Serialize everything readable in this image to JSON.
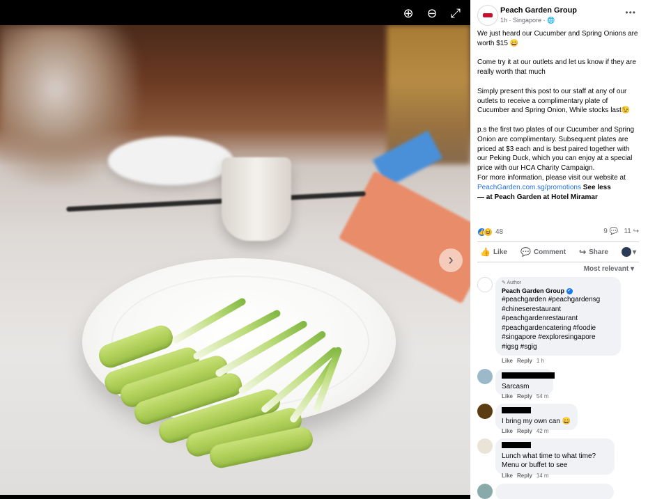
{
  "viewer": {
    "controls": [
      {
        "name": "zoom-in-icon",
        "glyph": "⊕"
      },
      {
        "name": "zoom-out-icon",
        "glyph": "⊖"
      },
      {
        "name": "fullscreen-icon",
        "glyph": "⤢"
      }
    ],
    "next_glyph": "›"
  },
  "post": {
    "page_name": "Peach Garden Group",
    "time": "1h",
    "location": "Singapore",
    "privacy_icon": "globe-icon",
    "more_label": "•••",
    "paragraphs": [
      "We just heard our Cucumber and Spring Onions are worth $15 😄",
      "Come try it at our outlets and let us know if they are really worth that much",
      "Simply present this post to our staff at any of our outlets to receive a complimentary plate of Cucumber and Spring Onion, While stocks last😉"
    ],
    "ps_text": "p.s the first two plates of our Cucumber and Spring Onion are complimentary. Subsequent plates are priced at $3 each and is best paired together with our Peking Duck, which you can enjoy at a special price with our HCA Charity Campaign.",
    "info_text": "For more information, please visit our website at",
    "link": "PeachGarden.com.sg/promotions",
    "see_less": "See less",
    "location_line": "— at Peach Garden at Hotel Miramar"
  },
  "stats": {
    "reactions": "48",
    "comments": "9",
    "shares": "11"
  },
  "actions": {
    "like": "Like",
    "comment": "Comment",
    "share": "Share"
  },
  "sort_label": "Most relevant",
  "comments": [
    {
      "badge": "Author",
      "name": "Peach Garden Group",
      "text_lines": [
        "#peachgarden #peachgardensg",
        "#chineserestaurant",
        "#peachgardenrestaurant",
        "#peachgardencatering #foodie",
        "#singapore #exploresingapore",
        "#igsg #sgig"
      ],
      "like": "Like",
      "reply": "Reply",
      "time": "1 h"
    },
    {
      "text_lines": [
        "Sarcasm"
      ],
      "like": "Like",
      "reply": "Reply",
      "time": "54 m"
    },
    {
      "text_lines": [
        "I bring my own can 😄"
      ],
      "like": "Like",
      "reply": "Reply",
      "time": "42 m"
    },
    {
      "text_lines": [
        "Lunch what time to what time?",
        "Menu or buffet to see"
      ],
      "like": "Like",
      "reply": "Reply",
      "time": "14 m"
    }
  ]
}
